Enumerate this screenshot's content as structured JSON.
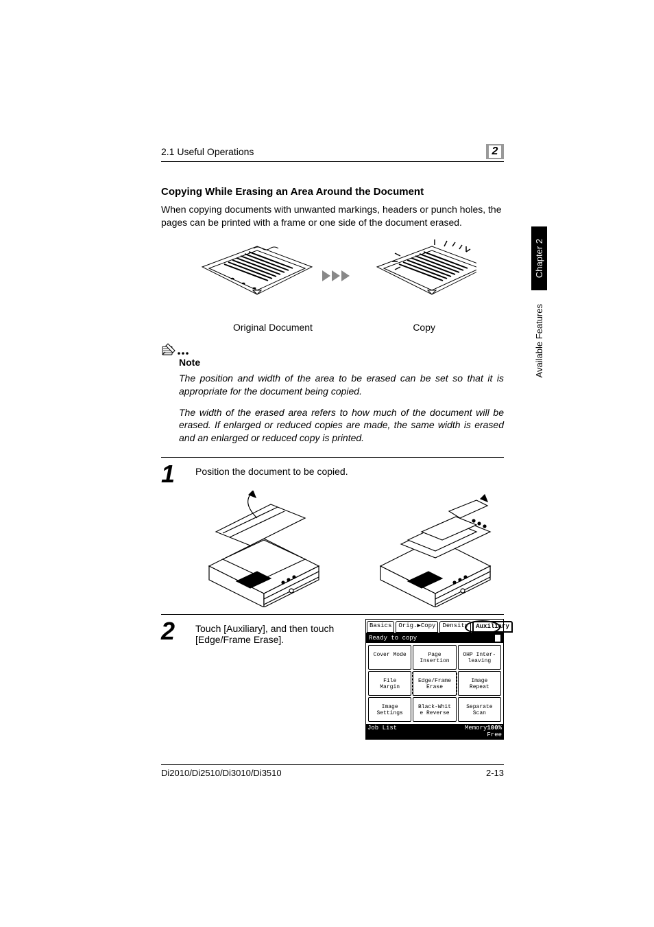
{
  "header": {
    "section": "2.1 Useful Operations",
    "chapter_number": "2"
  },
  "sidebar": {
    "chapter_tab": "Chapter 2",
    "section_name": "Available Features"
  },
  "content": {
    "title": "Copying While Erasing an Area Around the Document",
    "intro": "When copying documents with unwanted markings, headers or punch holes, the pages can be printed with a frame or one side of the document erased.",
    "figure": {
      "left_caption": "Original Document",
      "right_caption": "Copy"
    },
    "note": {
      "label": "Note",
      "para1": "The position and width of the area to be erased can be set so that it is appropriate for the document being copied.",
      "para2": "The width of the erased area refers to how much of the document will be erased. If enlarged or reduced copies are made, the same width is erased and an enlarged or reduced copy is printed."
    },
    "steps": [
      {
        "num": "1",
        "text": "Position the document to be copied."
      },
      {
        "num": "2",
        "text": "Touch [Auxiliary], and then touch [Edge/Frame Erase]."
      }
    ],
    "panel": {
      "tabs": [
        "Basics",
        "Orig.▶Copy",
        "Density",
        "Auxiliary"
      ],
      "status": "Ready to copy",
      "cells": [
        "Cover Mode",
        "Page\nInsertion",
        "OHP Inter-\nleaving",
        "File\nMargin",
        "Edge/Frame\nErase",
        "Image\nRepeat",
        "Image\nSettings",
        "Black-Whit\ne Reverse",
        "Separate\nScan"
      ],
      "job_list": "Job List",
      "memory_label": "Memory",
      "memory_value": "100%",
      "memory_free": "Free"
    }
  },
  "footer": {
    "model": "Di2010/Di2510/Di3010/Di3510",
    "page": "2-13"
  }
}
